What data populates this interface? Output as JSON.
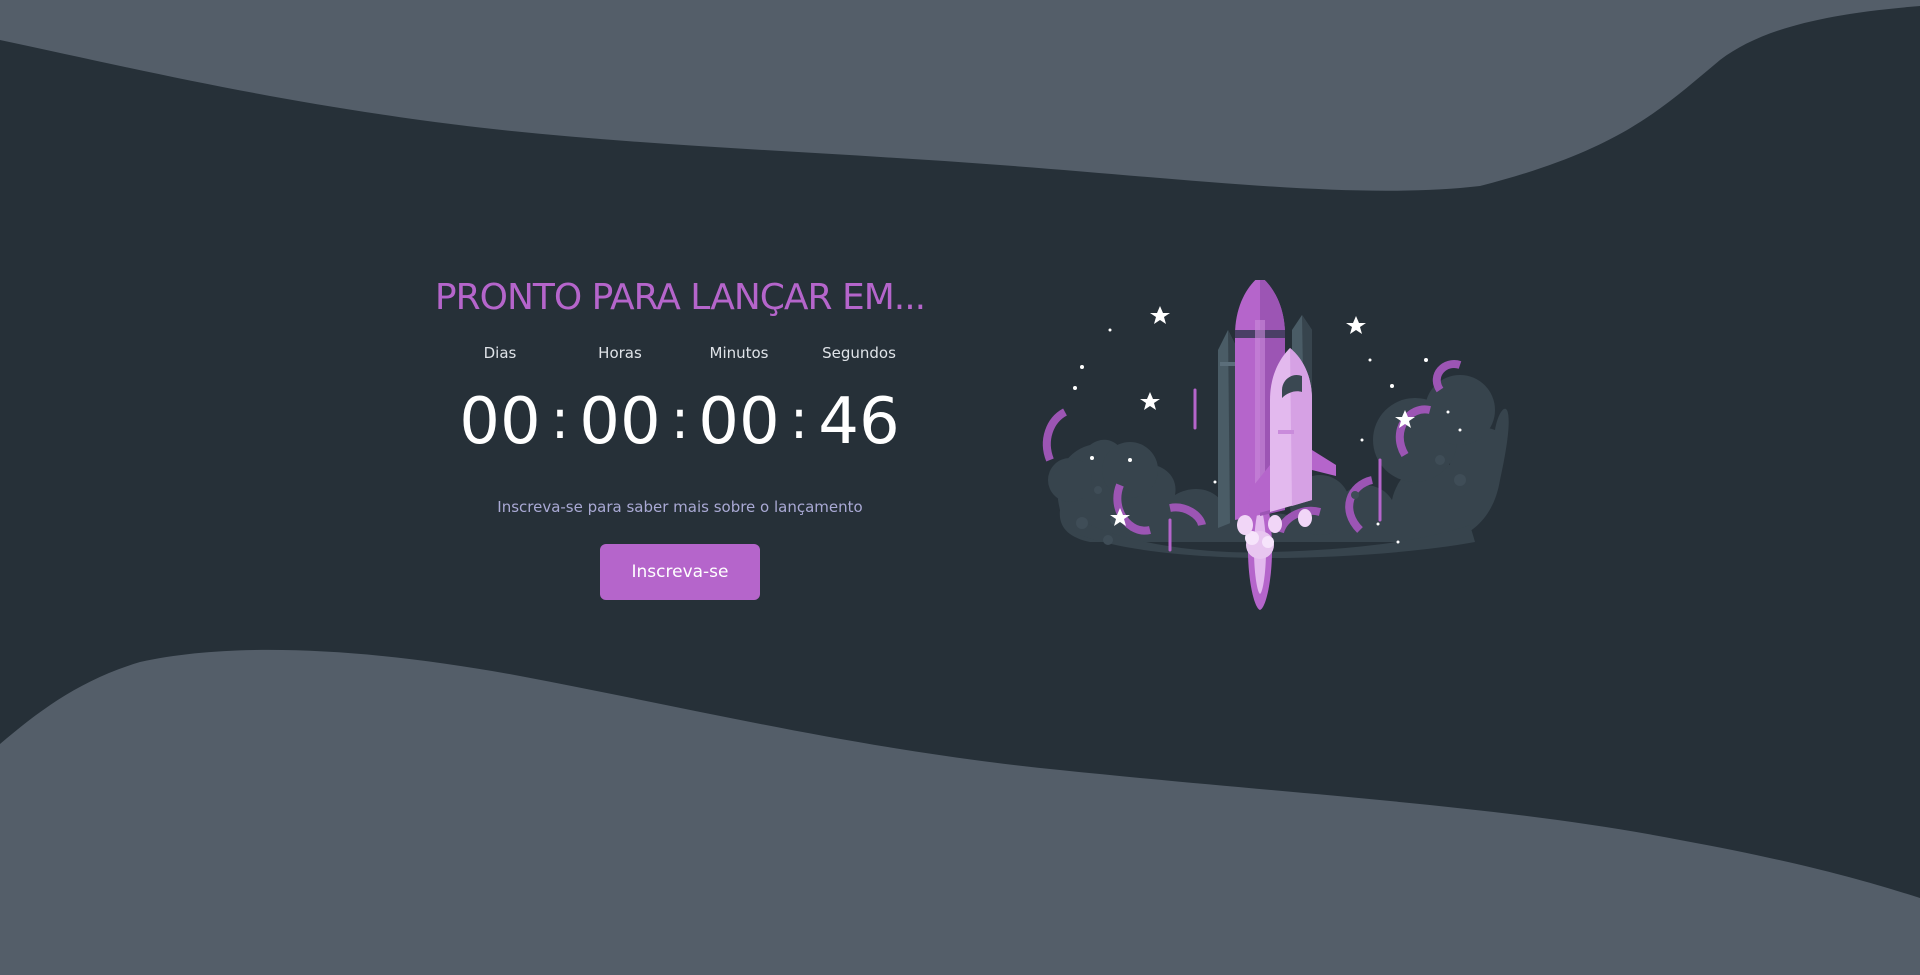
{
  "hero": {
    "headline": "PRONTO PARA LANÇAR EM...",
    "tagline": "Inscreva-se para saber mais sobre o lançamento",
    "subscribe_label": "Inscreva-se"
  },
  "countdown": {
    "days_label": "Dias",
    "hours_label": "Horas",
    "minutes_label": "Minutos",
    "seconds_label": "Segundos",
    "days": "00",
    "hours": "00",
    "minutes": "00",
    "seconds": "46",
    "separator": ":"
  },
  "colors": {
    "background": "#263038",
    "wave": "#545e69",
    "accent": "#b565cb",
    "tagline": "#a9a9d4",
    "text": "#ffffff"
  },
  "illustration": {
    "icon": "rocket-launch-illustration"
  }
}
